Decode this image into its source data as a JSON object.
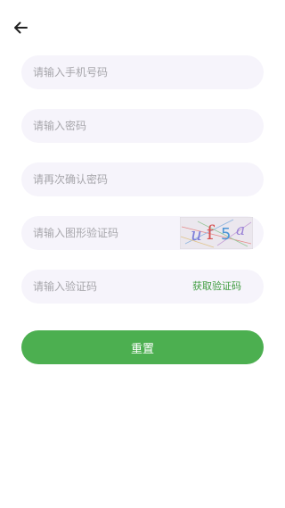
{
  "header": {
    "back_icon": "arrow-left-icon"
  },
  "form": {
    "phone": {
      "value": "",
      "placeholder": "请输入手机号码"
    },
    "password": {
      "value": "",
      "placeholder": "请输入密码"
    },
    "confirm_password": {
      "value": "",
      "placeholder": "请再次确认密码"
    },
    "captcha": {
      "value": "",
      "placeholder": "请输入图形验证码",
      "image_text": [
        "u",
        "f",
        "5",
        "a"
      ]
    },
    "sms_code": {
      "value": "",
      "placeholder": "请输入验证码",
      "get_code_label": "获取验证码"
    }
  },
  "submit": {
    "label": "重置"
  },
  "colors": {
    "accent": "#4caf50",
    "link": "#3f9c3f",
    "input_bg": "#f6f4fb",
    "placeholder": "#a7a6ab"
  }
}
